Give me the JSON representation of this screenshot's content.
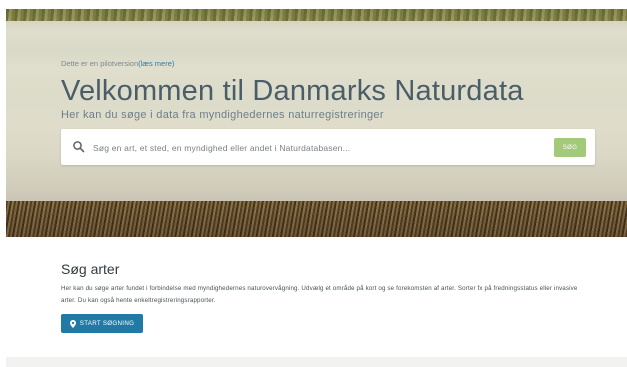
{
  "hero": {
    "pilot_text": "Dette er en pilotversion",
    "pilot_link": "(læs mere)",
    "title": "Velkommen til Danmarks Naturdata",
    "subtitle": "Her kan du søge i data fra myndighedernes naturregistreringer",
    "search": {
      "placeholder": "Søg en art, et sted, en myndighed eller andet i Naturdatabasen...",
      "button_label": "SØG"
    }
  },
  "species_section": {
    "title": "Søg arter",
    "description": "Her kan du søge arter fundet i forbindelse med myndighedernes naturovervågning. Udvælg et område på kort og se forekomsten af arter. Sorter fx på fredningsstatus eller invasive arter. Du kan også hente enkeltregistreringsrapporter.",
    "button_label": "START SØGNING"
  },
  "colors": {
    "accent_blue": "#217aa6",
    "search_green": "#a3c97a",
    "title_color": "#4a5d68"
  },
  "icons": {
    "search": "search-icon",
    "start": "map-pin-icon"
  }
}
